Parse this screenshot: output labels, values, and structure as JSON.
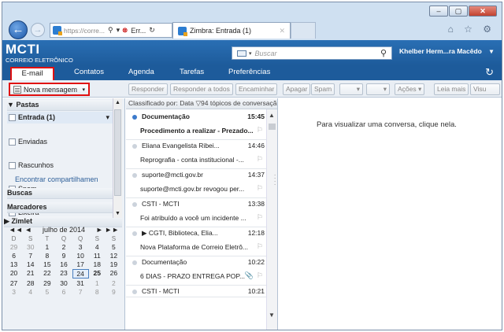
{
  "browser": {
    "address": "https://corre...",
    "address_icons": {
      "search": "⚲",
      "dropdown": "▾",
      "cert_error": "⊗",
      "cert_label": "Err...",
      "refresh": "↻"
    },
    "tab_title": "Zimbra: Entrada (1)",
    "tab_close": "✕",
    "toolbar_icons": "⌂ ☆ ⚙",
    "window_buttons": {
      "minimize": "–",
      "maximize": "▢",
      "close": "✕"
    }
  },
  "header": {
    "logo": "MCTI",
    "logo_sub": "CORREIO ELETRÔNICO",
    "search_placeholder": "Buscar",
    "search_dd": "▾",
    "search_icon": "⚲",
    "user": "Khelber Herm...ra Macêdo",
    "user_dd": "▾"
  },
  "nav": {
    "tabs": [
      "E-mail",
      "Contatos",
      "Agenda",
      "Tarefas",
      "Preferências"
    ],
    "refresh": "↻"
  },
  "toolbar": {
    "new_message": "Nova mensagem",
    "new_dd": "▾",
    "buttons": [
      "Responder",
      "Responder a todos",
      "Encaminhar",
      "Apagar",
      "Spam",
      "▾",
      "▾",
      "Ações ▾",
      "Leia mais",
      "Visu"
    ]
  },
  "sidebar": {
    "pastas": "Pastas",
    "pastas_toggle": "▼",
    "folders": [
      {
        "label": "Entrada (1)",
        "bold": true
      },
      {
        "label": "Enviadas"
      },
      {
        "label": "Rascunhos"
      },
      {
        "label": "Spam"
      },
      {
        "label": "Lixeira"
      }
    ],
    "inbox_dd": "▾",
    "share_link": "Encontrar compartilhamen",
    "buscas": "Buscas",
    "marcadores": "Marcadores",
    "zimlet": "Zimlet",
    "zimlet_toggle": "▶",
    "scroll_up": "▲",
    "scroll_down": "▼"
  },
  "calendar": {
    "month": "julho de 2014",
    "nav_prev": "◄◄ ◄",
    "nav_next": "► ►►",
    "days": [
      "D",
      "S",
      "T",
      "Q",
      "Q",
      "S",
      "S"
    ],
    "weeks": [
      [
        "29",
        "30",
        "1",
        "2",
        "3",
        "4",
        "5"
      ],
      [
        "6",
        "7",
        "8",
        "9",
        "10",
        "11",
        "12"
      ],
      [
        "13",
        "14",
        "15",
        "16",
        "17",
        "18",
        "19"
      ],
      [
        "20",
        "21",
        "22",
        "23",
        "24",
        "25",
        "26"
      ],
      [
        "27",
        "28",
        "29",
        "30",
        "31",
        "1",
        "2"
      ],
      [
        "3",
        "4",
        "5",
        "6",
        "7",
        "8",
        "9"
      ]
    ],
    "today": "24",
    "bold_day": "25"
  },
  "list": {
    "header": "Classificado por: Data  ▽94 tópicos de conversação",
    "flag": "⚐",
    "rows": [
      {
        "from": "Documentação",
        "time": "15:45",
        "subject": "Procedimento a realizar - Prezado...",
        "unread": true
      },
      {
        "from": "Eliana Evangelista Ribei...",
        "time": "14:46",
        "subject": "Reprografia - conta institucional -..."
      },
      {
        "from": "suporte@mcti.gov.br",
        "time": "14:37",
        "subject": "suporte@mcti.gov.br revogou per..."
      },
      {
        "from": "CSTI - MCTI",
        "time": "13:38",
        "subject": "Foi atribuído a você um incidente ..."
      },
      {
        "from": "▶  CGTI, Biblioteca, Elia...",
        "time": "12:18",
        "subject": "Nova Plataforma de Correio Eletrô..."
      },
      {
        "from": "Documentação",
        "time": "10:22",
        "subject": "6 DIAS - PRAZO ENTREGA POP...",
        "clip": "📎"
      },
      {
        "from": "CSTI - MCTI",
        "time": "10:21",
        "subject": ""
      }
    ]
  },
  "reading": {
    "empty": "Para visualizar uma conversa, clique nela."
  },
  "colors": {
    "brand": "#1d5b9b",
    "highlight": "#e01010"
  },
  "icons": [
    "back-arrow-icon",
    "forward-arrow-icon",
    "home-icon",
    "star-icon",
    "gear-icon",
    "envelope-icon",
    "search-icon",
    "refresh-icon",
    "compose-icon",
    "inbox-icon",
    "sent-icon",
    "drafts-icon",
    "spam-icon",
    "trash-icon",
    "flag-icon",
    "paperclip-icon"
  ]
}
